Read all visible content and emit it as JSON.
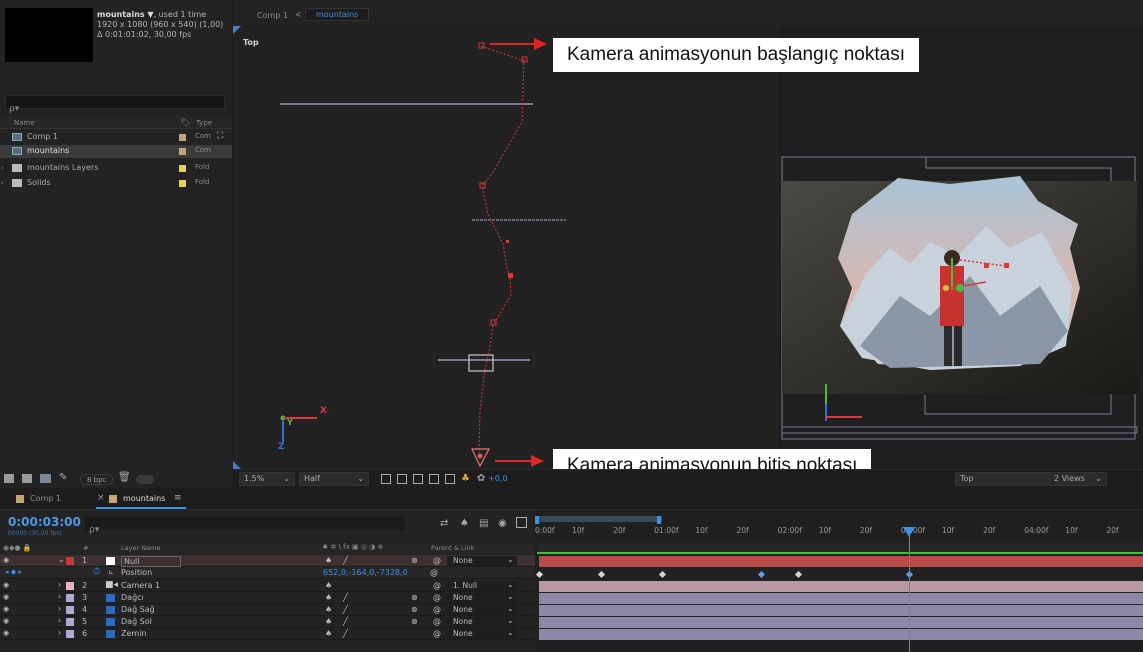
{
  "project": {
    "comp_name": "mountains ▼",
    "used": ", used 1 time",
    "resolution": "1920 x 1080  (960 x 540) (1,00)",
    "duration": "Δ 0:01:01:02, 30,00 fps",
    "search_icon": "ρ▾",
    "col_name": "Name",
    "col_type": "Type",
    "items": [
      {
        "name": "Comp 1",
        "type": "Com",
        "label_color": "#c7a57b",
        "icon": "comp-icon",
        "selected": false
      },
      {
        "name": "mountains",
        "type": "Com",
        "label_color": "#c7a57b",
        "icon": "comp-icon",
        "selected": true
      },
      {
        "name": "mountains Layers",
        "type": "Fold",
        "label_color": "#e7d34a",
        "icon": "folder-icon",
        "selected": false
      },
      {
        "name": "Solids",
        "type": "Fold",
        "label_color": "#e7d34a",
        "icon": "folder-icon",
        "selected": false
      }
    ],
    "bpc": "8 bpc"
  },
  "viewer": {
    "breadcrumb_parent": "Comp 1",
    "breadcrumb_sep": "<",
    "breadcrumb_current": "mountains",
    "left_view_label": "Top",
    "zoom": "1.5%",
    "resolution": "Half",
    "exposure": "+0,0",
    "view_select": "Top",
    "views_select": "2 Views",
    "axis_x": "X",
    "axis_y": "Y",
    "axis_z": "Z"
  },
  "annotations": {
    "start": "Kamera animasyonun başlangıç noktası",
    "end": "Kamera animasyonun bitiş noktası"
  },
  "timeline": {
    "tab1": "Comp 1",
    "tab2": "mountains",
    "tab2_menu": "≡",
    "close": "×",
    "timecode": "0:00:03:00",
    "timecode_sub": "00090 (30.00 fps)",
    "search_icon": "ρ▾",
    "hdr_layer_name": "Layer Name",
    "hdr_parent": "Parent & Link",
    "hdr_num": "#",
    "hdr_switches": "♠ ✲ \\ fx ▣ ◎ ◑ ⊕",
    "position_label": "Position",
    "position_value": "652,0,-164,0,-7328,0",
    "layers": [
      {
        "num": "1",
        "name": "Null",
        "color": "#c43a3a",
        "parent": "None",
        "highlight": true
      },
      {
        "num": "2",
        "name": "Camera 1",
        "color": "#e6b3c2",
        "parent": "1. Null",
        "highlight": false
      },
      {
        "num": "3",
        "name": "Dağcı",
        "color": "#b5a8d9",
        "parent": "None",
        "highlight": false
      },
      {
        "num": "4",
        "name": "Dağ Sağ",
        "color": "#b5a8d9",
        "parent": "None",
        "highlight": false
      },
      {
        "num": "5",
        "name": "Dağ Sol",
        "color": "#b5a8d9",
        "parent": "None",
        "highlight": false
      },
      {
        "num": "6",
        "name": "Zemin",
        "color": "#b5a8d9",
        "parent": "None",
        "highlight": false
      }
    ],
    "ruler": [
      "0:00f",
      "10f",
      "20f",
      "01:00f",
      "10f",
      "20f",
      "02:00f",
      "10f",
      "20f",
      "03:00f",
      "10f",
      "20f",
      "04:00f",
      "10f",
      "20f"
    ],
    "current_time_seconds": 3.0,
    "keyframes_seconds": [
      0.0,
      0.5,
      1.0,
      1.8,
      2.1,
      3.0
    ]
  }
}
